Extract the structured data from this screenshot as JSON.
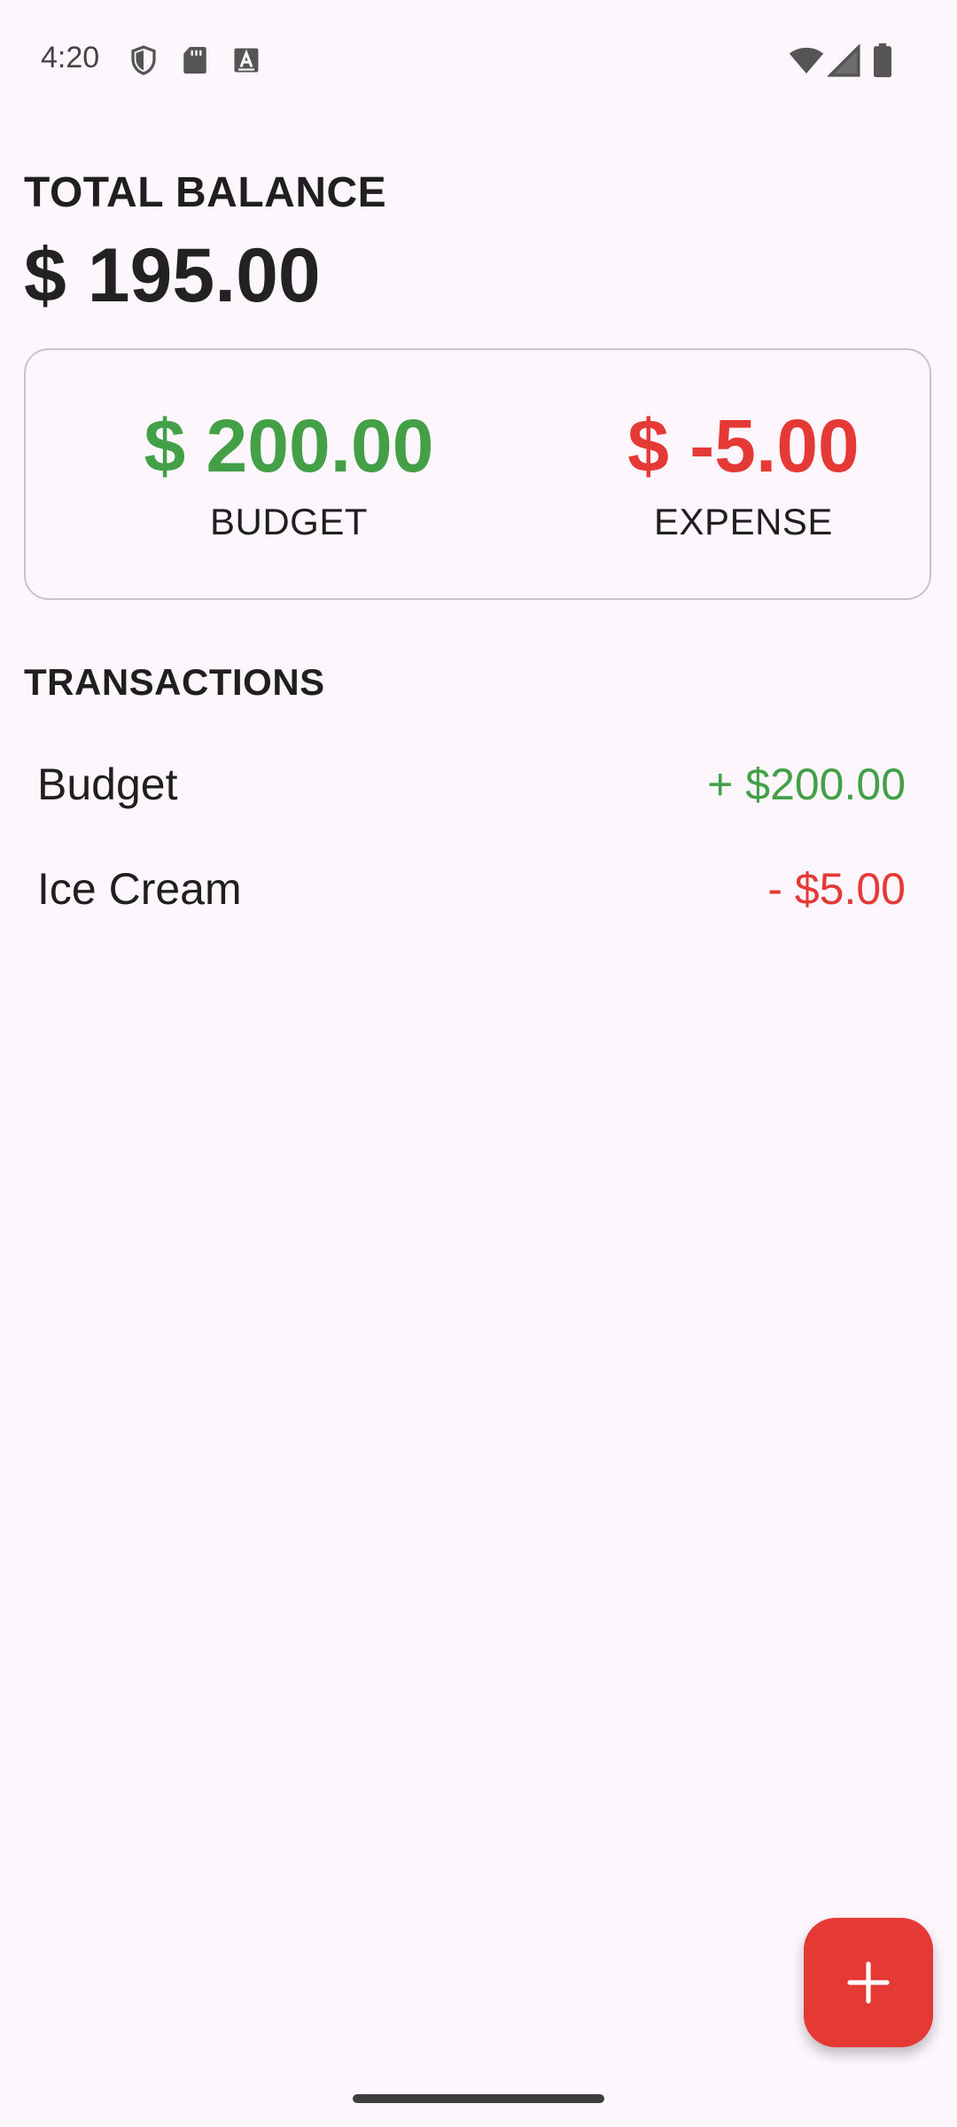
{
  "status_bar": {
    "time": "4:20",
    "left_icons": [
      "shield-icon",
      "sd-card-icon",
      "keyboard-a-icon"
    ],
    "right_icons": [
      "wifi-icon",
      "cell-signal-icon",
      "battery-icon"
    ]
  },
  "balance": {
    "label": "TOTAL BALANCE",
    "value": "$ 195.00"
  },
  "summary": {
    "budget_amount": "$ 200.00",
    "budget_label": "BUDGET",
    "expense_amount": "$ -5.00",
    "expense_label": "EXPENSE"
  },
  "transactions": {
    "title": "TRANSACTIONS",
    "items": [
      {
        "name": "Budget",
        "amount": "+ $200.00",
        "type": "income"
      },
      {
        "name": "Ice Cream",
        "amount": "- $5.00",
        "type": "expense"
      }
    ]
  },
  "fab": {
    "icon": "plus-icon"
  },
  "colors": {
    "background": "#fdf7fd",
    "income": "#43a047",
    "expense": "#e53935",
    "fab": "#e53935"
  }
}
